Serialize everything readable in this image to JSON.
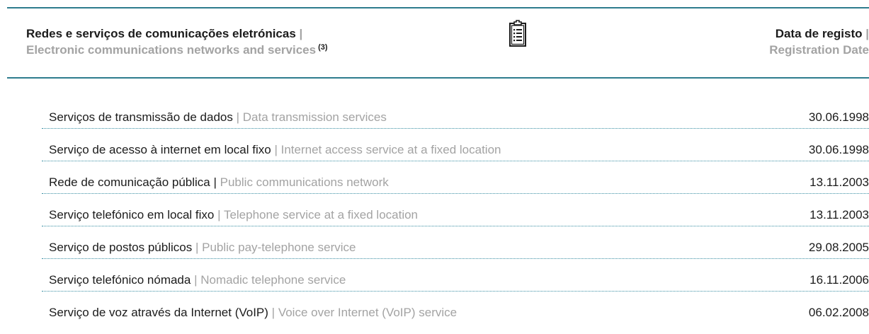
{
  "header": {
    "title_pt": "Redes e serviços de comunicações eletrónicas",
    "separator": "|",
    "title_en": "Electronic communications networks and services",
    "footnote": "(3)",
    "date_label_pt": "Data de registo",
    "date_label_en": "Registration Date",
    "icon": "clipboard-list-icon"
  },
  "rows": [
    {
      "pt": "Serviços de transmissão de dados",
      "sep": " | ",
      "en": "Data transmission services",
      "date": "30.06.1998"
    },
    {
      "pt": "Serviço de acesso à internet em local fixo",
      "sep": " | ",
      "en": "Internet access service at a fixed location",
      "date": "30.06.1998"
    },
    {
      "pt": "Rede de comunicação pública |",
      "sep": " ",
      "en": "Public communications network",
      "date": "13.11.2003"
    },
    {
      "pt": "Serviço telefónico em local fixo",
      "sep": " | ",
      "en": "Telephone service at a fixed location",
      "date": "13.11.2003"
    },
    {
      "pt": "Serviço de postos públicos",
      "sep": " | ",
      "en": "Public pay-telephone service",
      "date": "29.08.2005"
    },
    {
      "pt": "Serviço telefónico nómada",
      "sep": " | ",
      "en": "Nomadic telephone service",
      "date": "16.11.2006"
    },
    {
      "pt": "Serviço de voz através da Internet (VoIP)",
      "sep": " | ",
      "en": "Voice over Internet (VoIP) service",
      "date": "06.02.2008"
    }
  ],
  "colors": {
    "rule": "#2e7c8e",
    "primary_text": "#1b1b1b",
    "secondary_text": "#a3a3a3",
    "dotted_divider": "#3a8fa3"
  }
}
